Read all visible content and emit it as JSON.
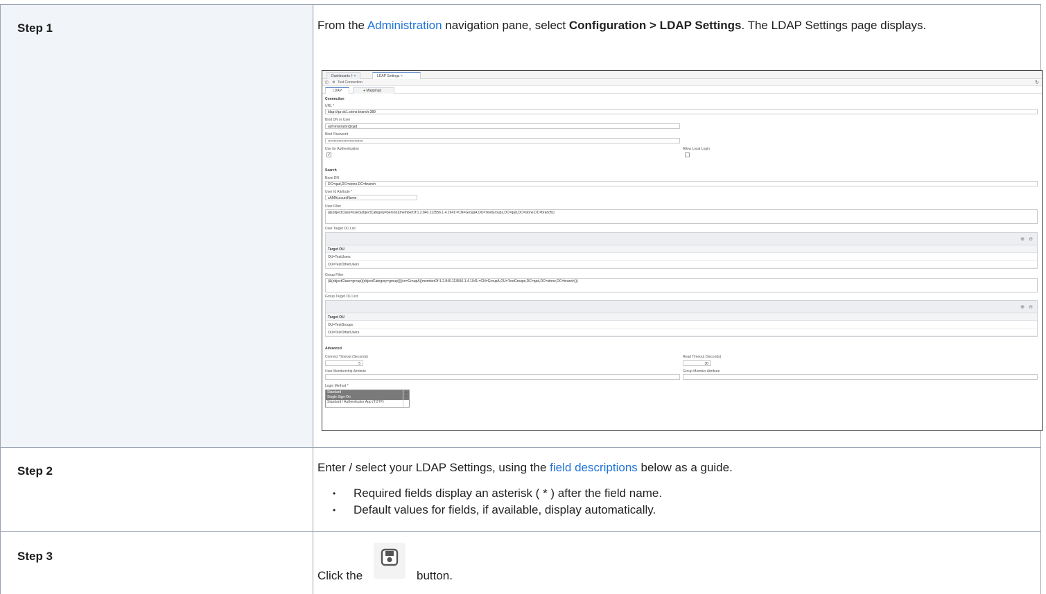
{
  "steps": [
    {
      "label": "Step 1",
      "text_prefix": "From the ",
      "link": "Administration",
      "text_mid": " navigation pane, select ",
      "bold": "Configuration > LDAP Settings",
      "text_suffix": ". The LDAP Settings page displays."
    },
    {
      "label": "Step 2",
      "text_prefix": "Enter / select your LDAP Settings, using the ",
      "link": "field descriptions",
      "text_suffix": " below as a guide.",
      "bullets": [
        "Required fields display an asterisk ( * ) after the field name.",
        "Default values for fields, if available, display automatically."
      ]
    },
    {
      "label": "Step 3",
      "text_prefix": "Click the",
      "text_suffix": "button.",
      "icon": "save-icon"
    }
  ],
  "screenshot": {
    "tabs": [
      "Dashboards † ×",
      "LDAP Settings ×"
    ],
    "toolbar": "Test Connection",
    "subtabs": [
      "LDAP",
      "Mappings"
    ],
    "sections": {
      "connection": "Connection",
      "search": "Search",
      "advanced": "Advanced"
    },
    "url_label": "URL *",
    "url_value": "ldap://qa-dc1.stone.branch:389",
    "bind_dn_label": "Bind DN or User",
    "bind_dn_value": "administrator@qad",
    "bind_pw_label": "Bind Password",
    "bind_pw_value": "•••••••••••••••••••••••••••••",
    "use_auth_label": "Use for Authentication",
    "allow_local_label": "Allow Local Login",
    "base_dn_label": "Base DN",
    "base_dn_value": "DC=qad,DC=stone,DC=branch",
    "user_id_label": "User Id Attribute *",
    "user_id_value": "sAMAccountName",
    "user_filter_label": "User Filter",
    "user_filter_value": "(&(objectClass=user)(objectCategory=person)(memberOf:1.2.840.113556.1.4.1941:=CN=GroupA,OU=TestGroups,DC=qad,DC=stone,DC=branch))",
    "user_ou_label": "User Target OU List",
    "target_ou_header": "Target OU",
    "user_ous": [
      "OU=TestUsers",
      "OU=TestOtherUsers"
    ],
    "group_filter_label": "Group Filter",
    "group_filter_value": "(&(objectClass=group)(objectCategory=group)(|(cn=GroupA)(memberOf:1.2.840.113556.1.4.1941:=CN=GroupA,OU=TestGroups,DC=qad,DC=stone,DC=branch)))",
    "group_ou_label": "Group Target OU List",
    "group_ous": [
      "OU=TestGroups",
      "OU=TestOtherUsers"
    ],
    "connect_timeout_label": "Connect Timeout (Seconds)",
    "connect_timeout_value": "5",
    "read_timeout_label": "Read Timeout (Seconds)",
    "read_timeout_value": "30",
    "user_membership_label": "User Membership Attribute",
    "group_member_label": "Group Member Attribute",
    "login_method_label": "Login Method *",
    "login_methods": [
      "Standard",
      "Single Sign-On",
      "Standard / Authenticator App (TOTP)"
    ]
  }
}
